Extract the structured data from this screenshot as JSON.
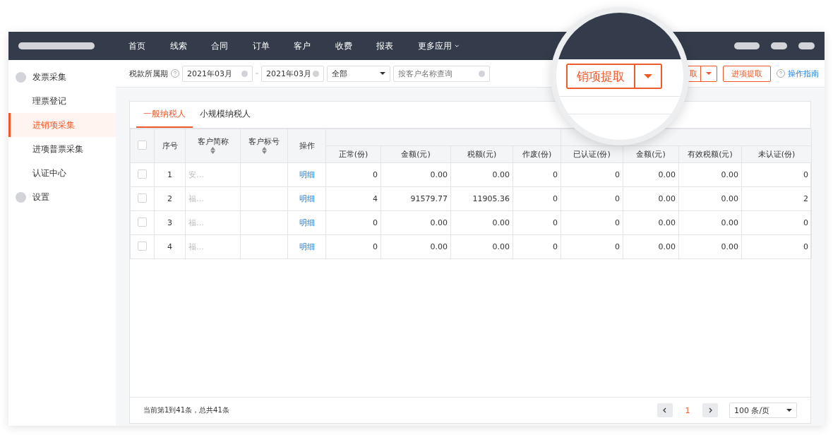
{
  "nav": {
    "items": [
      {
        "label": "首页"
      },
      {
        "label": "线索"
      },
      {
        "label": "合同"
      },
      {
        "label": "订单"
      },
      {
        "label": "客户"
      },
      {
        "label": "收费"
      },
      {
        "label": "报表"
      },
      {
        "label": "更多应用",
        "kind": "dropdown"
      }
    ]
  },
  "sidebar": {
    "items": [
      {
        "label": "发票采集",
        "selected": false,
        "children": [
          {
            "label": "理票登记",
            "selected": false
          },
          {
            "label": "进销项采集",
            "selected": true
          },
          {
            "label": "进项普票采集",
            "selected": false
          },
          {
            "label": "认证中心",
            "selected": false
          }
        ]
      },
      {
        "label": "设置",
        "selected": false
      }
    ]
  },
  "toolbar": {
    "period_label": "税款所属期",
    "start": "2021年03月",
    "end": "2021年03月",
    "type_select": "全部",
    "search": {
      "placeholder": "按客户名称查询"
    },
    "split_button": "取",
    "button": "进项提取",
    "help": "操作指南"
  },
  "magnifier": {
    "button": "销项提取"
  },
  "tabs": [
    {
      "label": "一般纳税人",
      "selected": true
    },
    {
      "label": "小规模纳税人",
      "selected": false
    }
  ],
  "table": {
    "header_checked": false,
    "columns": [
      "序号",
      "客户简称",
      "客户标号",
      "操作"
    ],
    "sortable": [
      false,
      true,
      true,
      false
    ],
    "sub_columns": [
      "正常(份)",
      "金额(元)",
      "税额(元)",
      "作废(份)",
      "已认证(份)",
      "金额(元)",
      "有效税额(元)",
      "未认证(份)"
    ],
    "rows": [
      {
        "checked": false,
        "cells": [
          "1",
          "安…",
          "",
          "明细",
          "0",
          "0.00",
          "0.00",
          "0",
          "0",
          "0.00",
          "0.00",
          "0"
        ]
      },
      {
        "checked": false,
        "cells": [
          "2",
          "福…",
          "",
          "明细",
          "4",
          "91579.77",
          "11905.36",
          "0",
          "0",
          "0.00",
          "0.00",
          "2"
        ]
      },
      {
        "checked": false,
        "cells": [
          "3",
          "福…",
          "",
          "明细",
          "0",
          "0.00",
          "0.00",
          "0",
          "0",
          "0.00",
          "0.00",
          "0"
        ]
      },
      {
        "checked": false,
        "cells": [
          "4",
          "福…",
          "",
          "明细",
          "0",
          "0.00",
          "0.00",
          "0",
          "0",
          "0.00",
          "0.00",
          "0"
        ]
      }
    ]
  },
  "footer": {
    "summary": "当前第1到41条，总共41条",
    "pages": [
      {
        "label": "1",
        "selected": true
      }
    ],
    "page_size": "100 条/页"
  }
}
